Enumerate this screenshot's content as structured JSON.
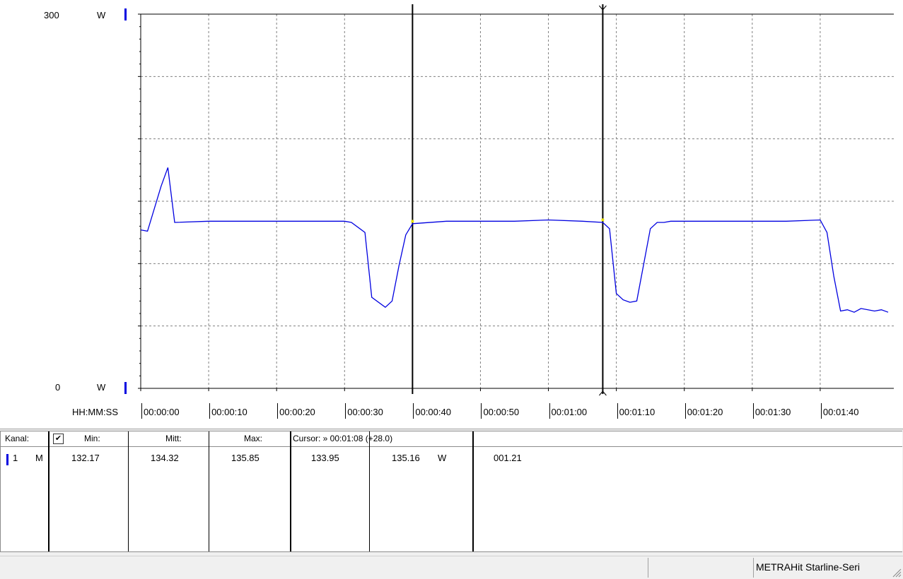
{
  "chart_data": {
    "type": "line",
    "title": "",
    "xlabel": "HH:MM:SS",
    "ylabel": "W",
    "ylim": [
      0,
      300
    ],
    "y_min_label": "0",
    "y_max_label": "300",
    "y_unit": "W",
    "xlim_seconds": [
      0,
      110
    ],
    "x_ticks": [
      "00:00:00",
      "00:00:10",
      "00:00:20",
      "00:00:30",
      "00:00:40",
      "00:00:50",
      "00:01:00",
      "00:01:10",
      "00:01:20",
      "00:01:30",
      "00:01:40"
    ],
    "grid": true,
    "series": [
      {
        "color": "#0000e0",
        "x": [
          0,
          1,
          3,
          4,
          5,
          10,
          15,
          20,
          25,
          30,
          31,
          33,
          34,
          36,
          37,
          38,
          39,
          40,
          45,
          50,
          55,
          60,
          65,
          68,
          69,
          70,
          71,
          72,
          73,
          74,
          75,
          76,
          77,
          78,
          79,
          80,
          85,
          90,
          95,
          100,
          101,
          102,
          103,
          104,
          105,
          106,
          108,
          109,
          110
        ],
        "y": [
          127,
          126,
          162,
          177,
          133,
          134,
          134,
          134,
          134,
          134,
          133,
          125,
          73,
          65,
          70,
          98,
          123,
          132,
          134,
          134,
          134,
          135,
          134,
          133,
          128,
          76,
          71,
          69,
          70,
          99,
          128,
          133,
          133,
          134,
          134,
          134,
          134,
          134,
          134,
          135,
          125,
          90,
          62,
          63,
          61,
          64,
          62,
          63,
          61
        ]
      }
    ],
    "cursors": [
      {
        "x_seconds": 40,
        "value": 133.95
      },
      {
        "x_seconds": 68,
        "value": 135.16
      }
    ]
  },
  "table": {
    "headers": {
      "kanal": "Kanal:",
      "check": "✔",
      "min": "Min:",
      "mitt": "Mitt:",
      "max": "Max:",
      "cursor": "Cursor: » 00:01:08 (+28.0)"
    },
    "row": {
      "channel": "1",
      "mode": "M",
      "min": "132.17",
      "mitt": "134.32",
      "max": "135.85",
      "cursor1": "133.95",
      "cursor2": "135.16",
      "unit": "W",
      "extra": "001.21"
    },
    "channel_color": "#0000e0"
  },
  "status": {
    "device": "METRAHit Starline-Seri"
  }
}
